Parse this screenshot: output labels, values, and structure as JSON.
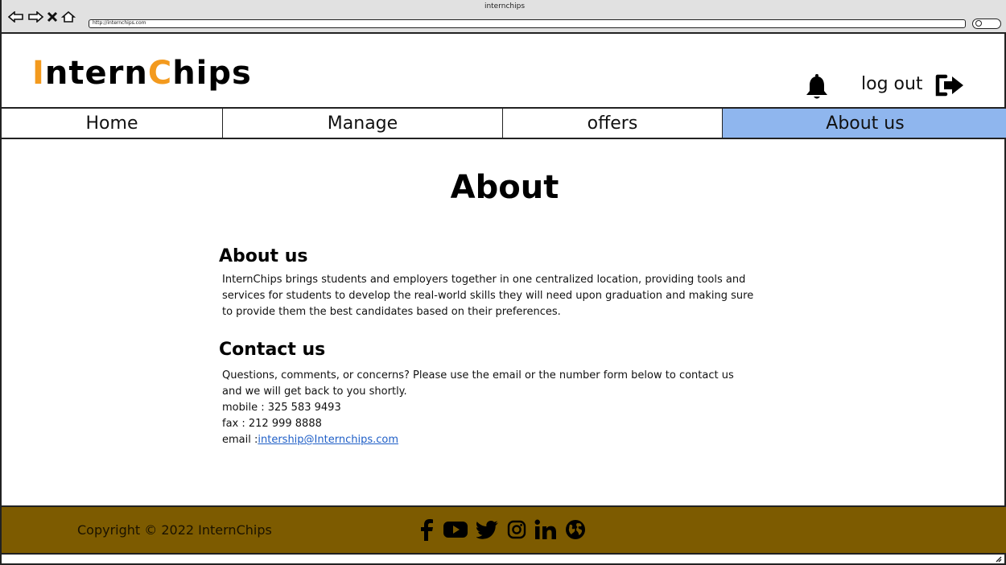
{
  "window": {
    "title": "internchips",
    "url": "http://internchips.com"
  },
  "header": {
    "logo_first_letter": "I",
    "logo_part_one": "ntern",
    "logo_second_letter": "C",
    "logo_part_two": "hips",
    "logout_label": "log out",
    "icons": [
      "bell-icon",
      "logout-icon"
    ]
  },
  "nav": {
    "tabs": [
      {
        "label": "Home",
        "active": false
      },
      {
        "label": "Manage",
        "active": false
      },
      {
        "label": "offers",
        "active": false
      },
      {
        "label": "About us",
        "active": true
      }
    ]
  },
  "main": {
    "heading": "About",
    "about": {
      "title": "About us",
      "lines": [
        "InternChips brings students and employers together in one centralized location, providing tools and",
        "services for students to develop the real-world skills they will need upon graduation and making sure",
        "to provide them the best candidates based on their preferences."
      ]
    },
    "contact": {
      "title": "Contact us",
      "lines": [
        "Questions, comments, or concerns? Please use the email or the number form below to contact us",
        "and we will get back to you shortly."
      ],
      "mobile": "mobile : 325 583 9493",
      "fax": "fax : 212 999 8888",
      "email_label": "email :",
      "email": "intership@Internchips.com"
    }
  },
  "footer": {
    "copyright": "Copyright © 2022 InternChips",
    "socials": [
      "facebook-icon",
      "youtube-icon",
      "twitter-icon",
      "instagram-icon",
      "linkedin-icon",
      "globe-icon"
    ]
  },
  "colors": {
    "logo_accent": "#f39a1e",
    "active_tab": "#8fb6ee",
    "footer_bg": "#7d5b00",
    "link": "#1f5fc7"
  }
}
